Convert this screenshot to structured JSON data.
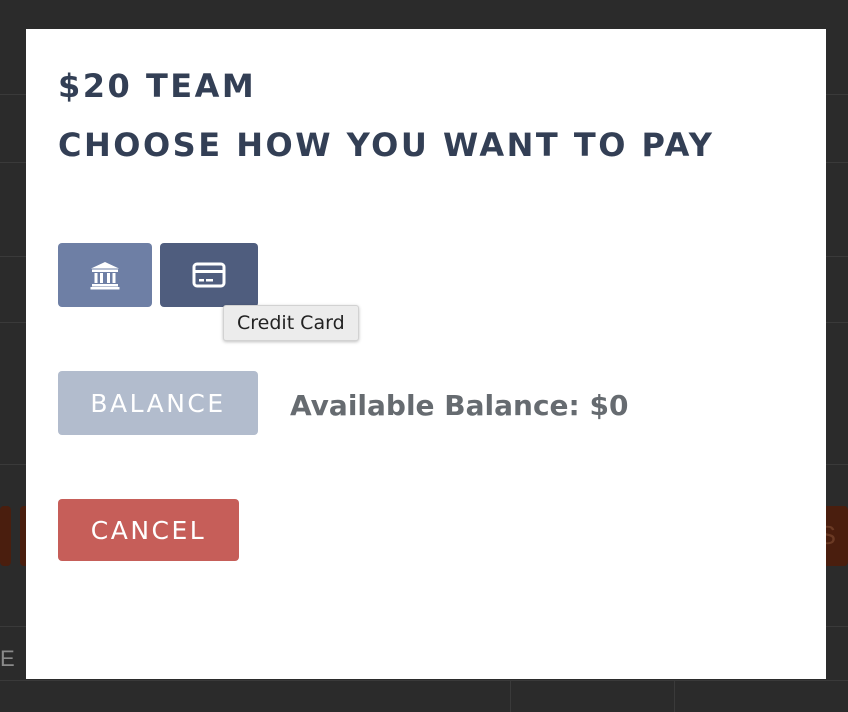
{
  "modal": {
    "title_price": "$20 TEAM",
    "title_prompt": "CHOOSE HOW YOU WANT TO PAY"
  },
  "payment_options": [
    {
      "icon": "bank-icon",
      "tooltip": ""
    },
    {
      "icon": "credit-card-icon",
      "tooltip": "Credit Card"
    }
  ],
  "tooltip": {
    "text": "Credit Card"
  },
  "balance": {
    "button_label": "BALANCE",
    "available_text": "Available Balance: $0"
  },
  "cancel": {
    "label": "CANCEL"
  },
  "background": {
    "button_fragment": "S",
    "left_letter": "E"
  },
  "colors": {
    "bank_button": "#6e7fa5",
    "card_button": "#4f5d7e",
    "balance_button": "#b2bccd",
    "cancel_button": "#c65e59",
    "title_text": "#333f55"
  }
}
